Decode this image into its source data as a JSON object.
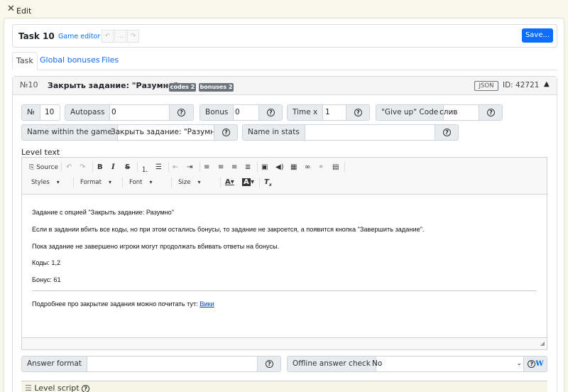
{
  "window": {
    "title": "Edit",
    "close_glyph": "✕"
  },
  "header": {
    "task_title": "Task 10",
    "game_editor_link": "Game editor",
    "undo_glyph": "↶",
    "ellipsis_glyph": "…",
    "redo_glyph": "↷",
    "save_label": "Save..."
  },
  "tabs": [
    {
      "label": "Task",
      "active": true
    },
    {
      "label": "Global bonuses",
      "active": false
    },
    {
      "label": "Files",
      "active": false
    }
  ],
  "level": {
    "number": "№10",
    "title": "Закрыть задание: \"Разумно\"",
    "codes_badge": "codes 2",
    "bonuses_badge": "bonuses 2",
    "json_button": "JSON",
    "id_text": "ID: 42721",
    "collapse_glyph": "▲"
  },
  "fields": {
    "number_label": "№",
    "number_value": "10",
    "autopass_label": "Autopass",
    "autopass_value": "0",
    "bonus_label": "Bonus",
    "bonus_value": "0",
    "timex_label": "Time x",
    "timex_value": "1",
    "giveup_label": "\"Give up\" Code",
    "giveup_value": "слив",
    "name_game_label": "Name within the game",
    "name_game_value": "Закрыть задание: \"Разумно\"",
    "name_stats_label": "Name in stats",
    "name_stats_value": "",
    "help_glyph": "?"
  },
  "editor": {
    "label": "Level text",
    "source_label": "Source",
    "styles_label": "Styles",
    "format_label": "Format",
    "font_label": "Font",
    "size_label": "Size",
    "font_color_icon": "font-color-icon",
    "bg_color_icon": "background-color-icon",
    "remove_format_icon": "remove-format-icon",
    "paragraphs": [
      "Задание с опцией \"Закрыть задание: Разумно\"",
      "Если в задании вбить все коды, но при этом остались бонусы, то задание не закроется, а появится кнопка \"Завершить задание\".",
      "Пока задание не завершено игроки могут продолжать вбивать ответы на бонусы.",
      "Коды: 1,2",
      "Бонус: 61"
    ],
    "footer_text": "Подробнее про закрытие задания можно почитать тут:",
    "footer_link": "Вики",
    "resize_glyph": "◢"
  },
  "answer": {
    "format_label": "Answer format",
    "format_value": "",
    "offline_label": "Offline answer check",
    "offline_value": "No",
    "wiki_glyph": "W"
  },
  "script": {
    "label": "Level script",
    "menu_glyph": "☰"
  },
  "colors": {
    "accent": "#0d6efd",
    "badge": "#6c757d",
    "window_bg": "#f7f7ea"
  }
}
